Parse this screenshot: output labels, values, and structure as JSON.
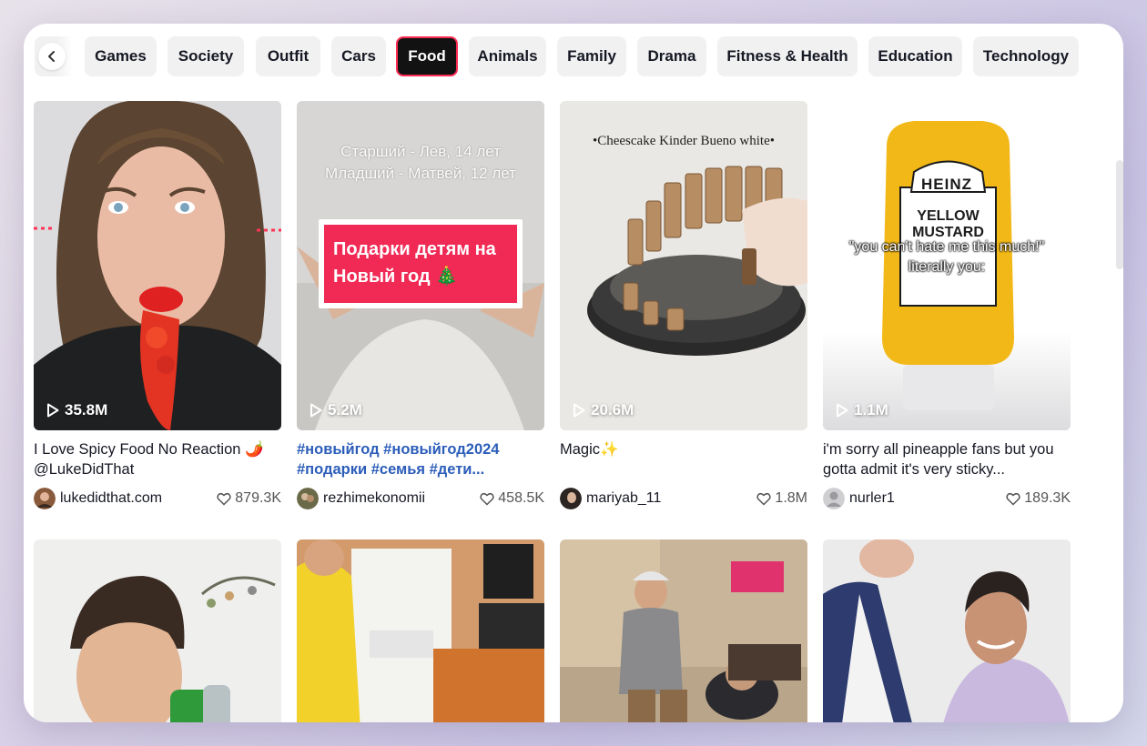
{
  "categories": [
    {
      "label": "Games",
      "active": false
    },
    {
      "label": "Society",
      "active": false
    },
    {
      "label": "Outfit",
      "active": false
    },
    {
      "label": "Cars",
      "active": false
    },
    {
      "label": "Food",
      "active": true
    },
    {
      "label": "Animals",
      "active": false
    },
    {
      "label": "Family",
      "active": false
    },
    {
      "label": "Drama",
      "active": false
    },
    {
      "label": "Fitness & Health",
      "active": false
    },
    {
      "label": "Education",
      "active": false
    },
    {
      "label": "Technology",
      "active": false
    }
  ],
  "videos": [
    {
      "views": "35.8M",
      "title": "I Love Spicy Food No Reaction 🌶️ @LukeDidThat",
      "author": "lukedidthat.com",
      "likes": "879.3K"
    },
    {
      "views": "5.2M",
      "title": "#новыйгод #новыйгод2024 #подарки #семья #дети...",
      "author": "rezhimekonomii",
      "likes": "458.5K",
      "overlay_top": "Старший - Лев, 14 лет\nМладший - Матвей, 12 лет",
      "overlay_banner": "Подарки детям на Новый год 🎄"
    },
    {
      "views": "20.6M",
      "title": "Magic✨",
      "author": "mariyab_11",
      "likes": "1.8M",
      "overlay_top": "•Cheescake Kinder Bueno white•"
    },
    {
      "views": "1.1M",
      "title": "i'm sorry all pineapple fans but you gotta admit it's very sticky...",
      "author": "nurler1",
      "likes": "189.3K",
      "overlay_caption": "\"you can't hate me this much!\"\nliterally you:",
      "bottle_brand": "HEINZ",
      "bottle_label": "YELLOW MUSTARD"
    }
  ],
  "colors": {
    "accent": "#fe2c55",
    "hashtag": "#2b5db9",
    "chip_bg": "#f1f1f2"
  }
}
